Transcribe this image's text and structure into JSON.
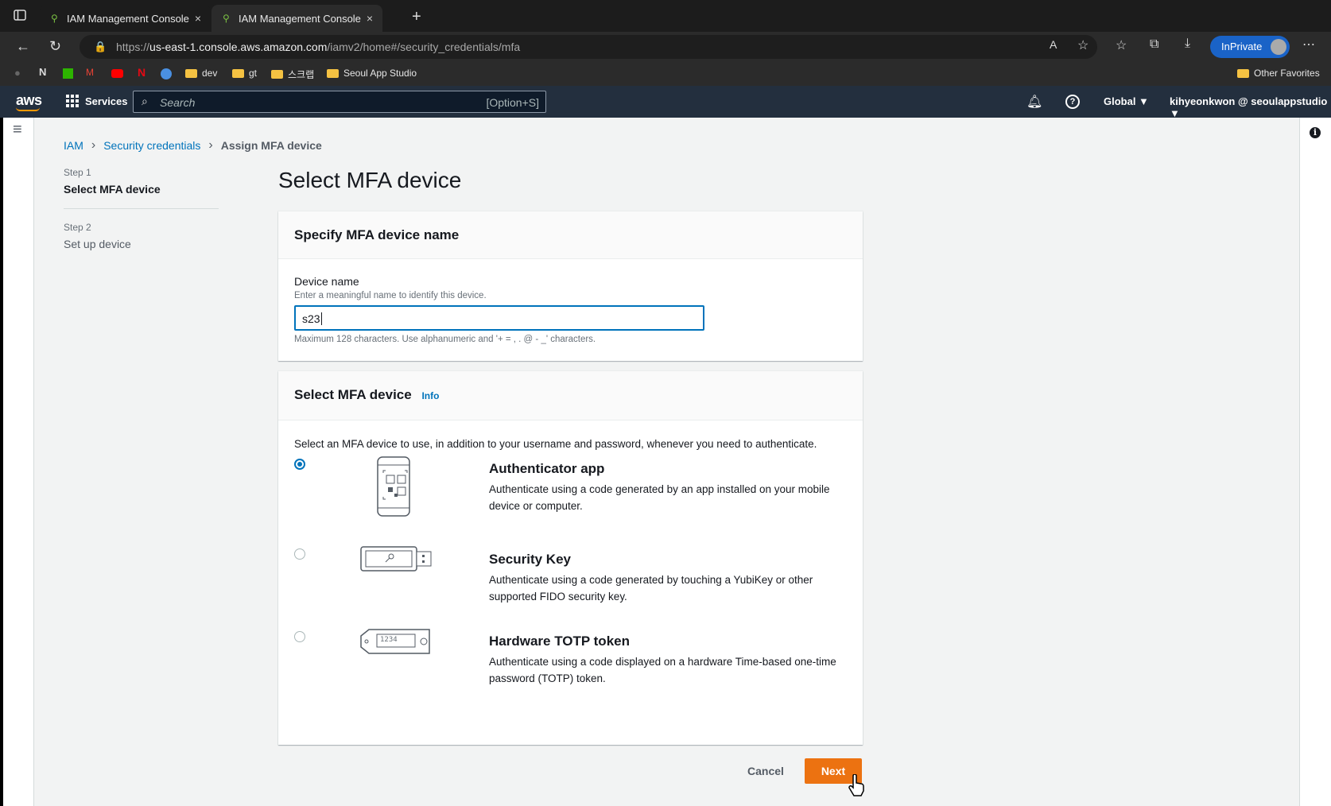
{
  "browser": {
    "tabs": [
      {
        "title": "IAM Management Console",
        "close": "×"
      },
      {
        "title": "IAM Management Console",
        "close": "×"
      }
    ],
    "new_tab": "+",
    "url_prefix": "https://",
    "url_host": "us-east-1.console.aws.amazon.com",
    "url_path": "/iamv2/home#/security_credentials/mfa",
    "inprivate": "InPrivate",
    "bookmarks": [
      "dev",
      "gt",
      "스크랩",
      "Seoul App Studio"
    ],
    "other_favorites": "Other Favorites"
  },
  "aws_nav": {
    "logo": "aws",
    "services": "Services",
    "search_placeholder": "Search",
    "search_shortcut": "[Option+S]",
    "region": "Global ▼",
    "account": "kihyeonkwon @ seoulappstudio ▼"
  },
  "breadcrumb": {
    "items": [
      "IAM",
      "Security credentials",
      "Assign MFA device"
    ]
  },
  "steps": [
    {
      "step": "Step 1",
      "label": "Select MFA device"
    },
    {
      "step": "Step 2",
      "label": "Set up device"
    }
  ],
  "page_title": "Select MFA device",
  "name_panel": {
    "header": "Specify MFA device name",
    "field_label": "Device name",
    "field_desc": "Enter a meaningful name to identify this device.",
    "field_value": "s23",
    "constraint": "Maximum 128 characters. Use alphanumeric and '+ = , . @ - _' characters."
  },
  "device_panel": {
    "header": "Select MFA device",
    "info": "Info",
    "intro": "Select an MFA device to use, in addition to your username and password, whenever you need to authenticate.",
    "options": [
      {
        "title": "Authenticator app",
        "desc": "Authenticate using a code generated by an app installed on your mobile device or computer.",
        "selected": true,
        "icon": "phone-qr-icon"
      },
      {
        "title": "Security Key",
        "desc": "Authenticate using a code generated by touching a YubiKey or other supported FIDO security key.",
        "selected": false,
        "icon": "security-key-icon"
      },
      {
        "title": "Hardware TOTP token",
        "desc": "Authenticate using a code displayed on a hardware Time-based one-time password (TOTP) token.",
        "selected": false,
        "icon": "totp-token-icon",
        "token_text": "1234"
      }
    ]
  },
  "actions": {
    "cancel": "Cancel",
    "next": "Next"
  }
}
